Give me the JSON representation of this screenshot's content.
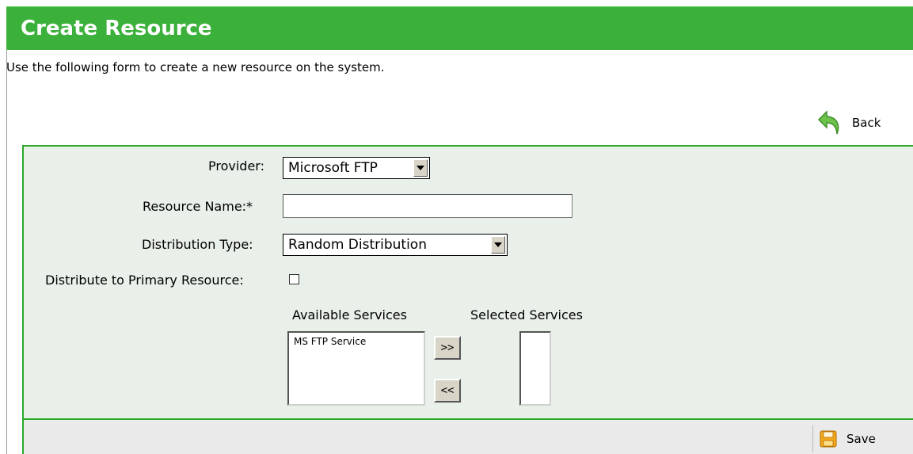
{
  "header": {
    "title": "Create Resource"
  },
  "description": "Use the following form to create a new resource on the system.",
  "back": {
    "label": "Back",
    "icon": "back-arrow-icon"
  },
  "form": {
    "provider": {
      "label": "Provider:",
      "value": "Microsoft FTP"
    },
    "resource_name": {
      "label": "Resource Name:*",
      "value": ""
    },
    "distribution_type": {
      "label": "Distribution Type:",
      "value": "Random Distribution"
    },
    "distribute_primary": {
      "label": "Distribute to Primary Resource:",
      "checked": false
    },
    "services": {
      "available_label": "Available Services",
      "selected_label": "Selected Services",
      "available": [
        "MS FTP Service"
      ],
      "selected": [],
      "add_label": ">>",
      "remove_label": "<<"
    }
  },
  "footer": {
    "save_label": "Save",
    "icon": "save-floppy-icon"
  },
  "colors": {
    "header_green": "#3bb13b",
    "panel_bg": "#e9efe9",
    "border_green": "#2aa82a"
  }
}
